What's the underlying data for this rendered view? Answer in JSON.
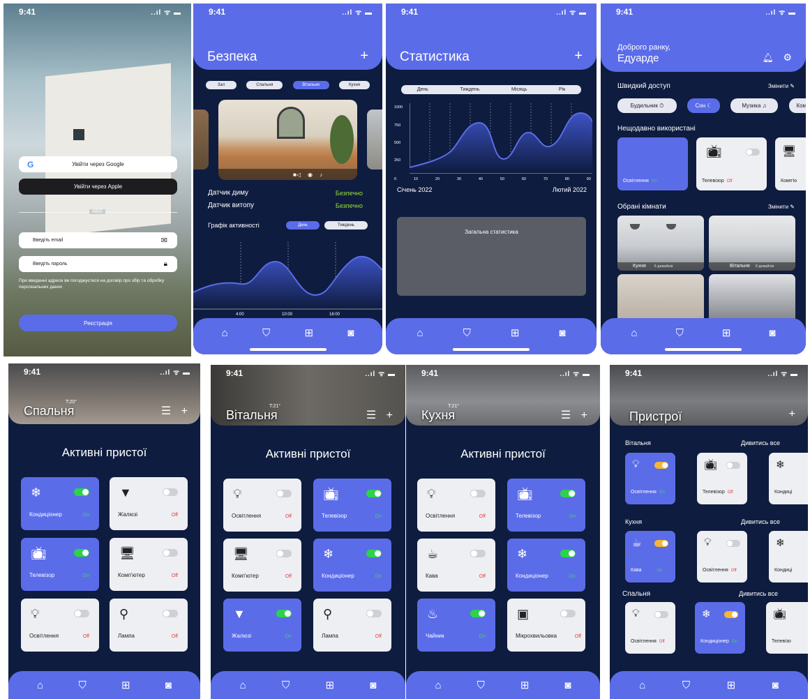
{
  "status": {
    "time": "9:41",
    "icons": "..ıl ᯤ ▬"
  },
  "login": {
    "google_btn": "Увійти через Google",
    "apple_btn": "Увійти через Apple",
    "divider": "АБО",
    "email_placeholder": "Введіть email",
    "password_placeholder": "Введіть пароль",
    "consent": "При введенні адреси ви погоджуєтеся на договір про збір та обробку персональних даних",
    "register_btn": "Реєстрація"
  },
  "security": {
    "title": "Безпека",
    "plus": "+",
    "rooms": [
      "Зал",
      "Спальня",
      "Вітальня",
      "Кухня"
    ],
    "active_room": 2,
    "smoke_label": "Датчик диму",
    "smoke_value": "Безпечно",
    "flood_label": "Датчик витопу",
    "flood_value": "Безпечно",
    "activity_label": "Графік активності",
    "day_chip": "День",
    "week_chip": "Тиждень",
    "ticks": [
      "4:00",
      "10:00",
      "16:00"
    ]
  },
  "stats": {
    "title": "Статистика",
    "plus": "+",
    "periods": [
      "День",
      "Тиждень",
      "Місяць",
      "Рік"
    ],
    "yticks": [
      "1000",
      "750",
      "500",
      "250"
    ],
    "xticks": [
      "0",
      "10",
      "20",
      "30",
      "40",
      "50",
      "60",
      "70",
      "80",
      "90"
    ],
    "start_label": "Січень 2022",
    "end_label": "Лютий 2022",
    "summary": "Загальна статистика"
  },
  "home": {
    "greeting": "Доброго ранку,",
    "name": "Едуарде",
    "quick_title": "Швидкий доступ",
    "change": "Змінити",
    "quick": [
      "Будильник ⏱",
      "Сон ☾",
      "Музика ♫",
      "Комп"
    ],
    "recent_title": "Нещодавно використані",
    "recent": [
      {
        "name": "Освітлення",
        "state": "On"
      },
      {
        "name": "Телевізор",
        "state": "Off"
      },
      {
        "name": "Комп'ю",
        "state": ""
      }
    ],
    "rooms_title": "Обрані кімнати",
    "change2": "Змінити",
    "rooms": [
      {
        "name": "Кухня",
        "count": "6 девайсів"
      },
      {
        "name": "Вітальня",
        "count": "9 девайсів"
      }
    ]
  },
  "bedroom": {
    "title": "Спальня",
    "temp": "T:20°",
    "active_title": "Активні пристої",
    "devices": [
      {
        "name": "Кондиціонер",
        "state": "On",
        "icon": "ac-icon",
        "on": true
      },
      {
        "name": "Жалюзі",
        "state": "Off",
        "icon": "blinds-icon",
        "on": false
      },
      {
        "name": "Телевізор",
        "state": "On",
        "icon": "tv-icon",
        "on": true
      },
      {
        "name": "Комп'ютер",
        "state": "Off",
        "icon": "computer-icon",
        "on": false
      },
      {
        "name": "Освітлення",
        "state": "Off",
        "icon": "bulb-icon",
        "on": false
      },
      {
        "name": "Лампа",
        "state": "Off",
        "icon": "lamp-icon",
        "on": false
      }
    ]
  },
  "living": {
    "title": "Вітальня",
    "temp": "T:21°",
    "active_title": "Активні пристої",
    "devices": [
      {
        "name": "Освітлення",
        "state": "Off",
        "icon": "bulb-icon",
        "on": false
      },
      {
        "name": "Телевізор",
        "state": "On",
        "icon": "tv-icon",
        "on": true
      },
      {
        "name": "Комп'ютер",
        "state": "Off",
        "icon": "computer-icon",
        "on": false
      },
      {
        "name": "Кондиціонер",
        "state": "On",
        "icon": "ac-icon",
        "on": true
      },
      {
        "name": "Жалюзі",
        "state": "On",
        "icon": "blinds-icon",
        "on": true
      },
      {
        "name": "Лампа",
        "state": "Off",
        "icon": "lamp-icon",
        "on": false
      }
    ]
  },
  "kitchen": {
    "title": "Кухня",
    "temp": "T:21°",
    "active_title": "Активні пристої",
    "devices": [
      {
        "name": "Освітлення",
        "state": "Off",
        "icon": "bulb-icon",
        "on": false
      },
      {
        "name": "Телевізор",
        "state": "On",
        "icon": "tv-icon",
        "on": true
      },
      {
        "name": "Кава",
        "state": "Off",
        "icon": "coffee-icon",
        "on": false
      },
      {
        "name": "Кондиціонер",
        "state": "On",
        "icon": "ac-icon",
        "on": true
      },
      {
        "name": "Чайник",
        "state": "On",
        "icon": "kettle-icon",
        "on": true
      },
      {
        "name": "Мікрохвильовка",
        "state": "Off",
        "icon": "microwave-icon",
        "on": false
      }
    ]
  },
  "devices": {
    "title": "Пристрої",
    "see_all": "Дивитись все",
    "groups": [
      {
        "room": "Вітальня",
        "items": [
          {
            "name": "Освітлення",
            "state": "On",
            "icon": "bulb-icon",
            "on": true
          },
          {
            "name": "Телевізор",
            "state": "Off",
            "icon": "tv-icon",
            "on": false
          },
          {
            "name": "Кондиці",
            "state": "",
            "icon": "ac-icon",
            "on": false
          }
        ]
      },
      {
        "room": "Кухня",
        "items": [
          {
            "name": "Кава",
            "state": "On",
            "icon": "coffee-icon",
            "on": true
          },
          {
            "name": "Освітлення",
            "state": "Off",
            "icon": "bulb-icon",
            "on": false
          },
          {
            "name": "Кондиці",
            "state": "",
            "icon": "ac-icon",
            "on": false
          }
        ]
      },
      {
        "room": "Спальня",
        "items": [
          {
            "name": "Освітлення",
            "state": "Off",
            "icon": "bulb-icon",
            "on": false
          },
          {
            "name": "Кондиціонер",
            "state": "On",
            "icon": "ac-icon",
            "on": true
          },
          {
            "name": "Телевізо",
            "state": "",
            "icon": "tv-icon",
            "on": false
          }
        ]
      }
    ]
  },
  "icons": {
    "bulb-icon": "💡︎",
    "tv-icon": "📺︎",
    "ac-icon": "❄",
    "blinds-icon": "▼",
    "computer-icon": "🖥︎",
    "lamp-icon": "⚲",
    "coffee-icon": "☕︎",
    "kettle-icon": "♨",
    "microwave-icon": "▣"
  },
  "nav": [
    "⌂",
    "⛉",
    "⊞",
    "◙"
  ],
  "colors": {
    "accent": "#5b6ce9",
    "dark": "#0e1c3f",
    "green": "#2bd34a",
    "yellow": "#f6b630",
    "red": "#e53b3b"
  }
}
